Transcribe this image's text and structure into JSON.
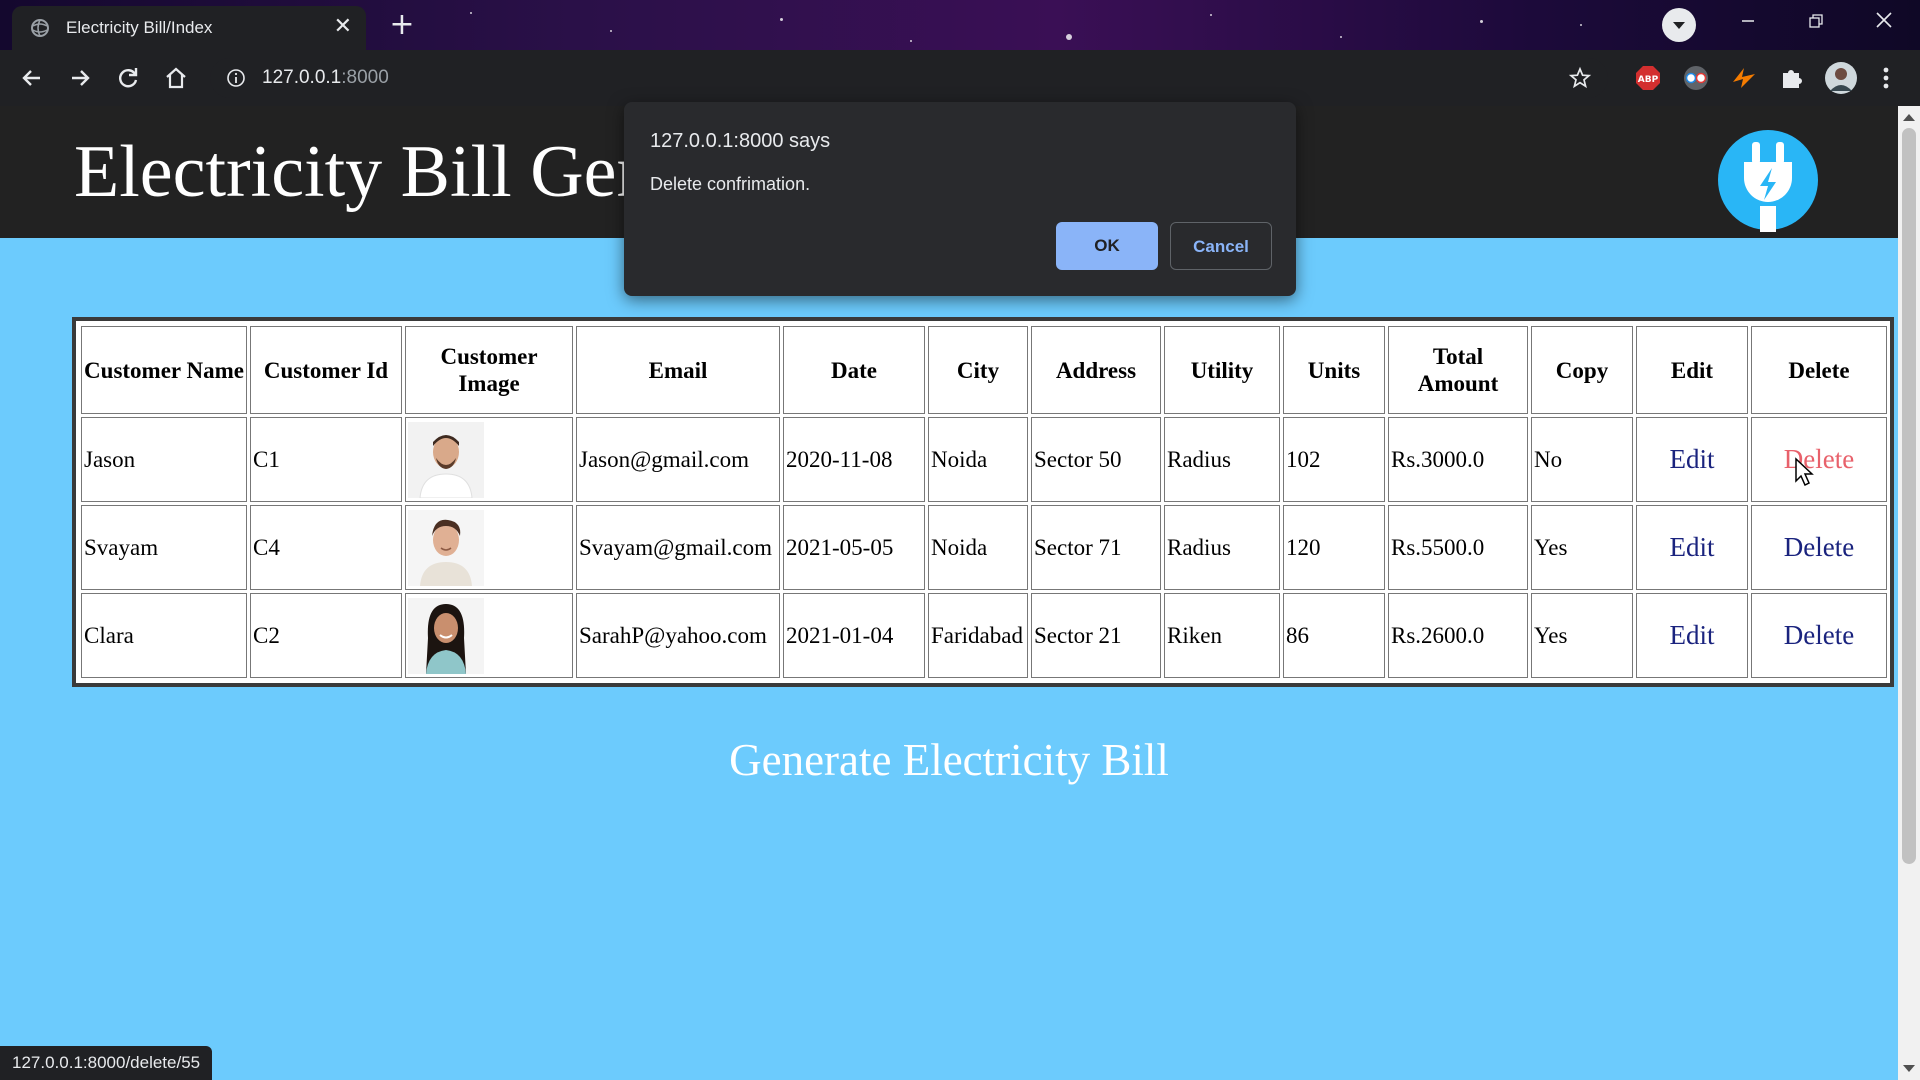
{
  "browser": {
    "tab_title": "Electricity Bill/Index",
    "url_host": "127.0.0.1",
    "url_port": ":8000",
    "status_url": "127.0.0.1:8000/delete/55"
  },
  "page": {
    "heading": "Electricity Bill Generator",
    "generate_link": "Generate Electricity Bill",
    "colors": {
      "background": "#6ccbfd",
      "header": "#222222",
      "link": "#1a237e",
      "link_hover": "#e8616b"
    }
  },
  "table": {
    "headers": [
      "Customer Name",
      "Customer Id",
      "Customer Image",
      "Email",
      "Date",
      "City",
      "Address",
      "Utility",
      "Units",
      "Total Amount",
      "Copy",
      "Edit",
      "Delete"
    ],
    "rows": [
      {
        "name": "Jason",
        "id": "C1",
        "image": "person-photo",
        "email": "Jason@gmail.com",
        "date": "2020-11-08",
        "city": "Noida",
        "address": "Sector 50",
        "utility": "Radius",
        "units": "102",
        "amount": "Rs.3000.0",
        "copy": "No",
        "edit": "Edit",
        "delete": "Delete"
      },
      {
        "name": "Svayam",
        "id": "C4",
        "image": "person-photo",
        "email": "Svayam@gmail.com",
        "date": "2021-05-05",
        "city": "Noida",
        "address": "Sector 71",
        "utility": "Radius",
        "units": "120",
        "amount": "Rs.5500.0",
        "copy": "Yes",
        "edit": "Edit",
        "delete": "Delete"
      },
      {
        "name": "Clara",
        "id": "C2",
        "image": "person-photo",
        "email": "SarahP@yahoo.com",
        "date": "2021-01-04",
        "city": "Faridabad",
        "address": "Sector 21",
        "utility": "Riken",
        "units": "86",
        "amount": "Rs.2600.0",
        "copy": "Yes",
        "edit": "Edit",
        "delete": "Delete"
      }
    ]
  },
  "dialog": {
    "title": "127.0.0.1:8000 says",
    "message": "Delete confrimation.",
    "ok": "OK",
    "cancel": "Cancel"
  }
}
